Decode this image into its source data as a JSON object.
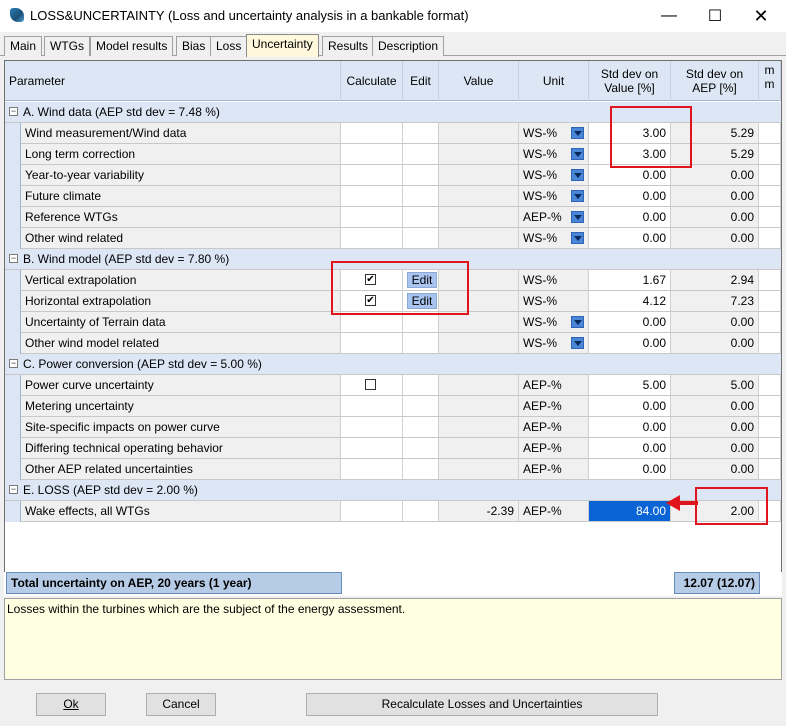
{
  "window": {
    "title": "LOSS&UNCERTAINTY (Loss and uncertainty analysis in a bankable format)",
    "minimize_glyph": "—",
    "maximize_glyph": "☐",
    "close_glyph": "✕"
  },
  "tabs": [
    {
      "label": "Main"
    },
    {
      "label": "WTGs"
    },
    {
      "label": "Model results"
    },
    {
      "label": "Bias"
    },
    {
      "label": "Loss"
    },
    {
      "label": "Uncertainty",
      "active": true
    },
    {
      "label": "Results"
    },
    {
      "label": "Description"
    }
  ],
  "grid": {
    "headers": {
      "parameter": "Parameter",
      "calculate": "Calculate",
      "edit": "Edit",
      "value": "Value",
      "unit": "Unit",
      "std_value": "Std dev on Value [%]",
      "std_aep": "Std dev on AEP [%]",
      "mm": "m m"
    },
    "groups": [
      {
        "label": "A. Wind data (AEP std dev =  7.48 %)",
        "toggle": "−",
        "rows": [
          {
            "param": "Wind measurement/Wind data",
            "calc": "",
            "edit": "",
            "value": "",
            "unit": "WS-%",
            "dropdown": true,
            "std_value": "3.00",
            "std_aep": "5.29"
          },
          {
            "param": "Long term correction",
            "calc": "",
            "edit": "",
            "value": "",
            "unit": "WS-%",
            "dropdown": true,
            "std_value": "3.00",
            "std_aep": "5.29"
          },
          {
            "param": "Year-to-year variability",
            "calc": "",
            "edit": "",
            "value": "",
            "unit": "WS-%",
            "dropdown": true,
            "std_value": "0.00",
            "std_aep": "0.00"
          },
          {
            "param": "Future climate",
            "calc": "",
            "edit": "",
            "value": "",
            "unit": "WS-%",
            "dropdown": true,
            "std_value": "0.00",
            "std_aep": "0.00"
          },
          {
            "param": "Reference WTGs",
            "calc": "",
            "edit": "",
            "value": "",
            "unit": "AEP-%",
            "dropdown": true,
            "std_value": "0.00",
            "std_aep": "0.00"
          },
          {
            "param": "Other wind related",
            "calc": "",
            "edit": "",
            "value": "",
            "unit": "WS-%",
            "dropdown": true,
            "std_value": "0.00",
            "std_aep": "0.00"
          }
        ]
      },
      {
        "label": "B. Wind model (AEP std dev =  7.80 %)",
        "toggle": "−",
        "rows": [
          {
            "param": "Vertical extrapolation",
            "calc": "checked",
            "edit": "Edit",
            "value": "",
            "unit": "WS-%",
            "dropdown": false,
            "std_value": "1.67",
            "std_aep": "2.94"
          },
          {
            "param": "Horizontal extrapolation",
            "calc": "checked",
            "edit": "Edit",
            "value": "",
            "unit": "WS-%",
            "dropdown": false,
            "std_value": "4.12",
            "std_aep": "7.23"
          },
          {
            "param": "Uncertainty of Terrain data",
            "calc": "",
            "edit": "",
            "value": "",
            "unit": "WS-%",
            "dropdown": true,
            "std_value": "0.00",
            "std_aep": "0.00"
          },
          {
            "param": "Other wind model related",
            "calc": "",
            "edit": "",
            "value": "",
            "unit": "WS-%",
            "dropdown": true,
            "std_value": "0.00",
            "std_aep": "0.00"
          }
        ]
      },
      {
        "label": "C. Power conversion (AEP std dev =  5.00 %)",
        "toggle": "−",
        "rows": [
          {
            "param": "Power curve uncertainty",
            "calc": "unchecked",
            "edit": "",
            "value": "",
            "unit": "AEP-%",
            "dropdown": false,
            "std_value": "5.00",
            "std_aep": "5.00"
          },
          {
            "param": "Metering uncertainty",
            "calc": "",
            "edit": "",
            "value": "",
            "unit": "AEP-%",
            "dropdown": false,
            "std_value": "0.00",
            "std_aep": "0.00"
          },
          {
            "param": "Site-specific impacts on power curve",
            "calc": "",
            "edit": "",
            "value": "",
            "unit": "AEP-%",
            "dropdown": false,
            "std_value": "0.00",
            "std_aep": "0.00"
          },
          {
            "param": "Differing technical operating behavior",
            "calc": "",
            "edit": "",
            "value": "",
            "unit": "AEP-%",
            "dropdown": false,
            "std_value": "0.00",
            "std_aep": "0.00"
          },
          {
            "param": "Other AEP related uncertainties",
            "calc": "",
            "edit": "",
            "value": "",
            "unit": "AEP-%",
            "dropdown": false,
            "std_value": "0.00",
            "std_aep": "0.00"
          }
        ]
      },
      {
        "label": "E. LOSS (AEP std dev =  2.00 %)",
        "toggle": "−",
        "rows": [
          {
            "param": "Wake effects, all WTGs",
            "calc": "",
            "edit": "",
            "value": "-2.39",
            "unit": "AEP-%",
            "dropdown": false,
            "std_value": "84.00",
            "std_aep": "2.00",
            "selected": true
          }
        ]
      }
    ]
  },
  "totals": {
    "label": "Total uncertainty on AEP, 20 years (1 year)",
    "value": "12.07 (12.07)"
  },
  "description": "Losses within the turbines which are the subject of the energy assessment.",
  "buttons": {
    "ok": "Ok",
    "cancel": "Cancel",
    "recalc": "Recalculate Losses and Uncertainties"
  }
}
